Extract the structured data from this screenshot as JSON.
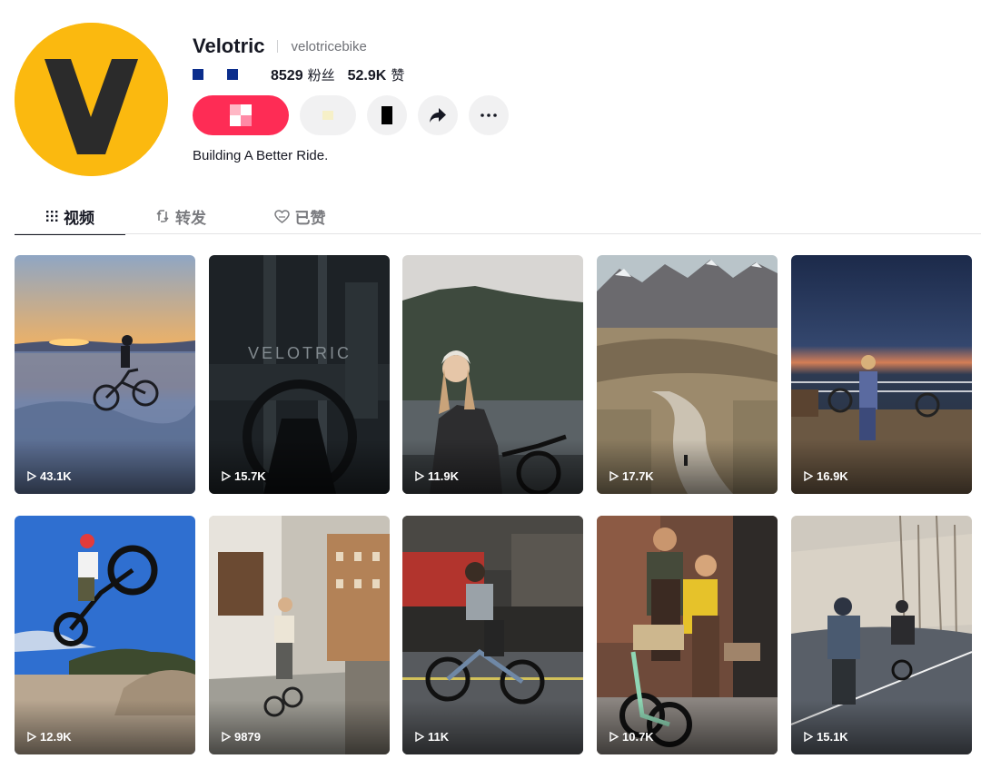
{
  "profile": {
    "username": "Velotric",
    "handle": "velotricebike",
    "followers_count": "8529",
    "followers_label": "粉丝",
    "likes_count": "52.9K",
    "likes_label": "赞",
    "bio": "Building A Better Ride.",
    "avatar_letter": "V",
    "avatar_color": "#fbb90f",
    "accent_color": "#fe2c55"
  },
  "tabs": [
    {
      "label": "视频",
      "icon": "grid-icon",
      "active": true
    },
    {
      "label": "转发",
      "icon": "repost-icon",
      "active": false
    },
    {
      "label": "已赞",
      "icon": "heart-icon",
      "active": false
    }
  ],
  "videos": [
    {
      "views": "43.1K"
    },
    {
      "views": "15.7K"
    },
    {
      "views": "11.9K"
    },
    {
      "views": "17.7K"
    },
    {
      "views": "16.9K"
    },
    {
      "views": "12.9K"
    },
    {
      "views": "9879"
    },
    {
      "views": "11K"
    },
    {
      "views": "10.7K"
    },
    {
      "views": "15.1K"
    }
  ],
  "thumbnail_text": {
    "video_2_overlay": "VELOTRIC"
  }
}
